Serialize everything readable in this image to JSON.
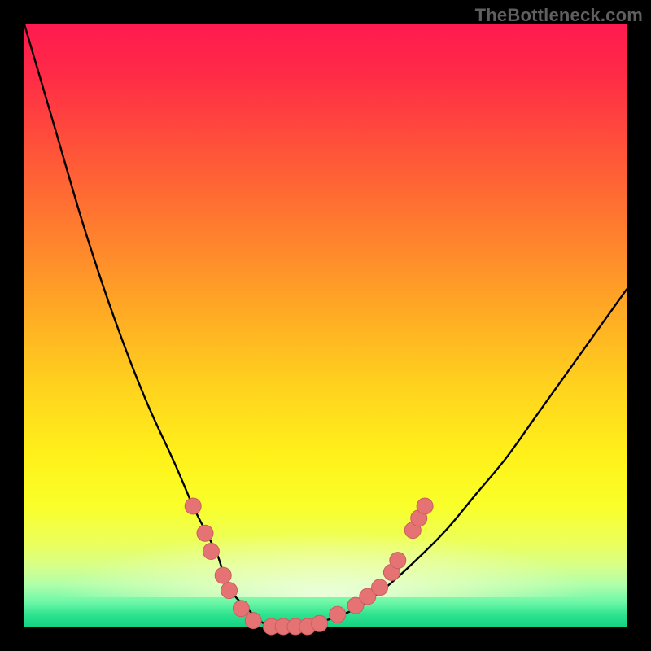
{
  "watermark": "TheBottleneck.com",
  "colors": {
    "frame": "#000000",
    "curve": "#000000",
    "marker_fill": "#e57373",
    "marker_stroke": "#c95e5e",
    "gradient_top": "#ff1a4f",
    "gradient_bottom": "#14d385"
  },
  "chart_data": {
    "type": "line",
    "title": "",
    "xlabel": "",
    "ylabel": "",
    "xlim": [
      0,
      100
    ],
    "ylim": [
      0,
      100
    ],
    "grid": false,
    "x": [
      0,
      5,
      10,
      15,
      20,
      25,
      28,
      30,
      32,
      33,
      34,
      35,
      37,
      38,
      39,
      41,
      43,
      46,
      50,
      55,
      60,
      65,
      70,
      75,
      80,
      85,
      90,
      95,
      100
    ],
    "y": [
      100,
      83,
      66,
      51,
      38,
      27,
      20,
      16,
      12,
      9,
      6.5,
      5,
      3,
      2,
      1,
      0,
      0,
      0,
      1,
      3,
      6.5,
      11,
      16,
      22,
      28,
      35,
      42,
      49,
      56
    ],
    "markers": [
      {
        "x": 28.0,
        "y": 20.0
      },
      {
        "x": 30.0,
        "y": 15.5
      },
      {
        "x": 31.0,
        "y": 12.5
      },
      {
        "x": 33.0,
        "y": 8.5
      },
      {
        "x": 34.0,
        "y": 6.0
      },
      {
        "x": 36.0,
        "y": 3.0
      },
      {
        "x": 38.0,
        "y": 1.0
      },
      {
        "x": 41.0,
        "y": 0.0
      },
      {
        "x": 43.0,
        "y": 0.0
      },
      {
        "x": 45.0,
        "y": 0.0
      },
      {
        "x": 47.0,
        "y": 0.0
      },
      {
        "x": 49.0,
        "y": 0.5
      },
      {
        "x": 52.0,
        "y": 2.0
      },
      {
        "x": 55.0,
        "y": 3.5
      },
      {
        "x": 57.0,
        "y": 5.0
      },
      {
        "x": 59.0,
        "y": 6.5
      },
      {
        "x": 61.0,
        "y": 9.0
      },
      {
        "x": 62.0,
        "y": 11.0
      },
      {
        "x": 64.5,
        "y": 16.0
      },
      {
        "x": 65.5,
        "y": 18.0
      },
      {
        "x": 66.5,
        "y": 20.0
      }
    ]
  }
}
